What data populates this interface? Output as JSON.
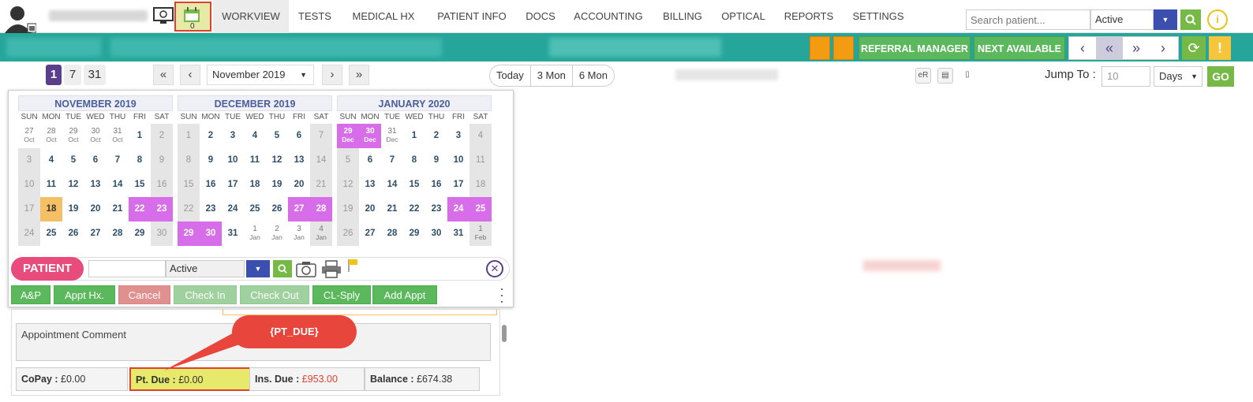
{
  "nav": {
    "tabs": [
      "WORKVIEW",
      "TESTS",
      "MEDICAL HX",
      "PATIENT INFO",
      "DOCS",
      "ACCOUNTING",
      "BILLING",
      "OPTICAL",
      "REPORTS",
      "SETTINGS"
    ],
    "calendar_badge": "0",
    "search_placeholder": "Search patient...",
    "status_value": "Active"
  },
  "toolbar": {
    "referral_label": "REFERRAL MANAGER",
    "next_available_label": "NEXT AVAILABLE",
    "view_day": "1",
    "view_week": "7",
    "view_month": "31",
    "month_select": "November 2019",
    "today_label": "Today",
    "three_mon_label": "3 Mon",
    "six_mon_label": "6 Mon",
    "er_label": "eR",
    "jump_label": "Jump To :",
    "jump_value": "10",
    "jump_unit": "Days",
    "go_label": "GO"
  },
  "calendars": [
    {
      "title": "NOVEMBER 2019",
      "weeks": [
        [
          {
            "n": "27",
            "s": "Oct",
            "t": "oth"
          },
          {
            "n": "28",
            "s": "Oct",
            "t": "oth"
          },
          {
            "n": "29",
            "s": "Oct",
            "t": "oth"
          },
          {
            "n": "30",
            "s": "Oct",
            "t": "oth"
          },
          {
            "n": "31",
            "s": "Oct",
            "t": "oth"
          },
          {
            "n": "1",
            "t": ""
          },
          {
            "n": "2",
            "t": "we"
          }
        ],
        [
          {
            "n": "3",
            "t": "we"
          },
          {
            "n": "4",
            "t": ""
          },
          {
            "n": "5",
            "t": ""
          },
          {
            "n": "6",
            "t": ""
          },
          {
            "n": "7",
            "t": ""
          },
          {
            "n": "8",
            "t": ""
          },
          {
            "n": "9",
            "t": "we"
          }
        ],
        [
          {
            "n": "10",
            "t": "we"
          },
          {
            "n": "11",
            "t": ""
          },
          {
            "n": "12",
            "t": ""
          },
          {
            "n": "13",
            "t": ""
          },
          {
            "n": "14",
            "t": ""
          },
          {
            "n": "15",
            "t": ""
          },
          {
            "n": "16",
            "t": "we"
          }
        ],
        [
          {
            "n": "17",
            "t": "we"
          },
          {
            "n": "18",
            "t": "today"
          },
          {
            "n": "19",
            "t": ""
          },
          {
            "n": "20",
            "t": ""
          },
          {
            "n": "21",
            "t": ""
          },
          {
            "n": "22",
            "t": "pur"
          },
          {
            "n": "23",
            "t": "pur"
          }
        ],
        [
          {
            "n": "24",
            "t": "we"
          },
          {
            "n": "25",
            "t": ""
          },
          {
            "n": "26",
            "t": ""
          },
          {
            "n": "27",
            "t": ""
          },
          {
            "n": "28",
            "t": ""
          },
          {
            "n": "29",
            "t": ""
          },
          {
            "n": "30",
            "t": "we"
          }
        ]
      ]
    },
    {
      "title": "DECEMBER 2019",
      "weeks": [
        [
          {
            "n": "1",
            "t": "we"
          },
          {
            "n": "2",
            "t": ""
          },
          {
            "n": "3",
            "t": ""
          },
          {
            "n": "4",
            "t": ""
          },
          {
            "n": "5",
            "t": ""
          },
          {
            "n": "6",
            "t": ""
          },
          {
            "n": "7",
            "t": "we"
          }
        ],
        [
          {
            "n": "8",
            "t": "we"
          },
          {
            "n": "9",
            "t": ""
          },
          {
            "n": "10",
            "t": ""
          },
          {
            "n": "11",
            "t": ""
          },
          {
            "n": "12",
            "t": ""
          },
          {
            "n": "13",
            "t": ""
          },
          {
            "n": "14",
            "t": "we"
          }
        ],
        [
          {
            "n": "15",
            "t": "we"
          },
          {
            "n": "16",
            "t": ""
          },
          {
            "n": "17",
            "t": ""
          },
          {
            "n": "18",
            "t": ""
          },
          {
            "n": "19",
            "t": ""
          },
          {
            "n": "20",
            "t": ""
          },
          {
            "n": "21",
            "t": "we"
          }
        ],
        [
          {
            "n": "22",
            "t": "we"
          },
          {
            "n": "23",
            "t": ""
          },
          {
            "n": "24",
            "t": ""
          },
          {
            "n": "25",
            "t": ""
          },
          {
            "n": "26",
            "t": ""
          },
          {
            "n": "27",
            "t": "pur"
          },
          {
            "n": "28",
            "t": "pur"
          }
        ],
        [
          {
            "n": "29",
            "t": "pur"
          },
          {
            "n": "30",
            "t": "pur"
          },
          {
            "n": "31",
            "t": ""
          },
          {
            "n": "1",
            "s": "Jan",
            "t": "oth"
          },
          {
            "n": "2",
            "s": "Jan",
            "t": "oth"
          },
          {
            "n": "3",
            "s": "Jan",
            "t": "oth"
          },
          {
            "n": "4",
            "s": "Jan",
            "t": "we oth"
          }
        ]
      ]
    },
    {
      "title": "JANUARY 2020",
      "weeks": [
        [
          {
            "n": "29",
            "s": "Dec",
            "t": "pur oth"
          },
          {
            "n": "30",
            "s": "Dec",
            "t": "pur oth"
          },
          {
            "n": "31",
            "s": "Dec",
            "t": "oth"
          },
          {
            "n": "1",
            "t": ""
          },
          {
            "n": "2",
            "t": ""
          },
          {
            "n": "3",
            "t": ""
          },
          {
            "n": "4",
            "t": "we"
          }
        ],
        [
          {
            "n": "5",
            "t": "we"
          },
          {
            "n": "6",
            "t": ""
          },
          {
            "n": "7",
            "t": ""
          },
          {
            "n": "8",
            "t": ""
          },
          {
            "n": "9",
            "t": ""
          },
          {
            "n": "10",
            "t": ""
          },
          {
            "n": "11",
            "t": "we"
          }
        ],
        [
          {
            "n": "12",
            "t": "we"
          },
          {
            "n": "13",
            "t": ""
          },
          {
            "n": "14",
            "t": ""
          },
          {
            "n": "15",
            "t": ""
          },
          {
            "n": "16",
            "t": ""
          },
          {
            "n": "17",
            "t": ""
          },
          {
            "n": "18",
            "t": "we"
          }
        ],
        [
          {
            "n": "19",
            "t": "we"
          },
          {
            "n": "20",
            "t": ""
          },
          {
            "n": "21",
            "t": ""
          },
          {
            "n": "22",
            "t": ""
          },
          {
            "n": "23",
            "t": ""
          },
          {
            "n": "24",
            "t": "pur"
          },
          {
            "n": "25",
            "t": "pur"
          }
        ],
        [
          {
            "n": "26",
            "t": "we"
          },
          {
            "n": "27",
            "t": ""
          },
          {
            "n": "28",
            "t": ""
          },
          {
            "n": "29",
            "t": ""
          },
          {
            "n": "30",
            "t": ""
          },
          {
            "n": "31",
            "t": ""
          },
          {
            "n": "1",
            "s": "Feb",
            "t": "we oth"
          }
        ]
      ]
    }
  ],
  "weekdays": [
    "SUN",
    "MON",
    "TUE",
    "WED",
    "THU",
    "FRI",
    "SAT"
  ],
  "patient": {
    "label": "PATIENT",
    "status": "Active"
  },
  "actions": [
    "A&P",
    "Appt Hx.",
    "Cancel",
    "Check In",
    "Check Out",
    "CL-Sply",
    "Add Appt"
  ],
  "comment_placeholder": "Appointment Comment",
  "finance": {
    "copay_label": "CoPay :",
    "copay": "£0.00",
    "ptdue_label": "Pt. Due :",
    "ptdue": "£0.00",
    "insdue_label": "Ins. Due :",
    "insdue": "£953.00",
    "balance_label": "Balance :",
    "balance": "£674.38"
  },
  "callout": "{PT_DUE}",
  "colors": {
    "teal": "#26a69a",
    "purple_day": "#d76de8",
    "today": "#f5c063",
    "green": "#5cb85c",
    "callout": "#e8453c"
  }
}
